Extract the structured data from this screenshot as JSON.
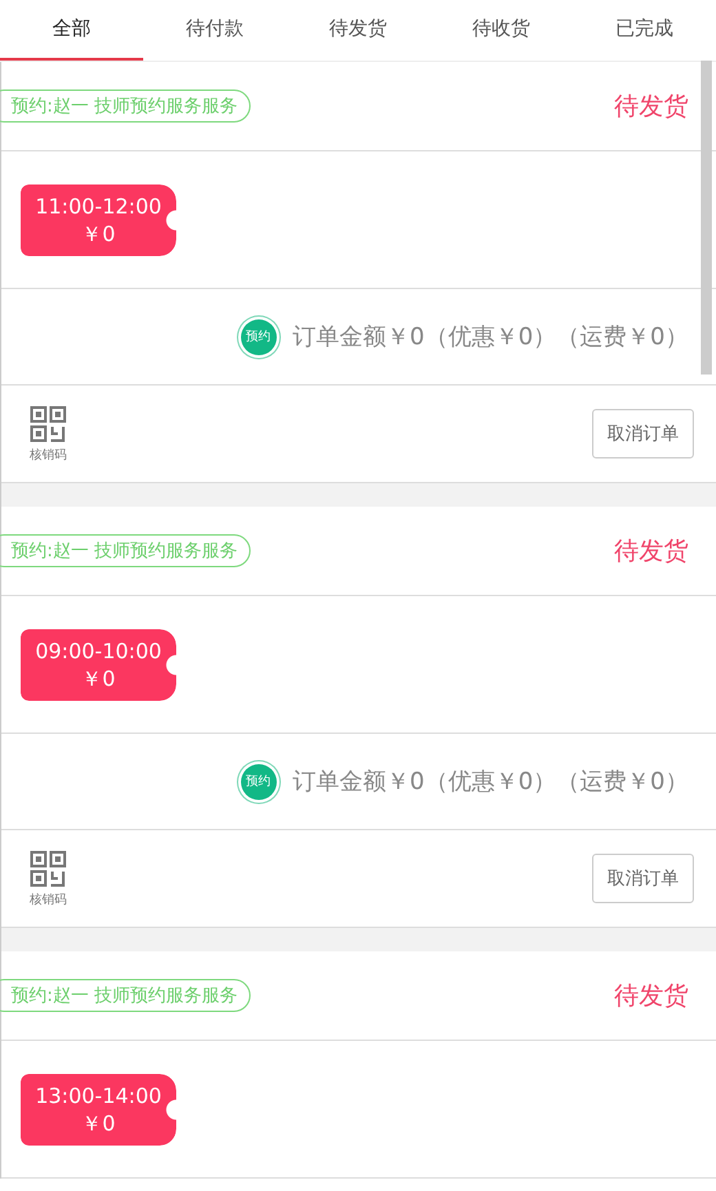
{
  "tabs": [
    {
      "label": "全部",
      "selected": true
    },
    {
      "label": "待付款",
      "selected": false
    },
    {
      "label": "待发货",
      "selected": false
    },
    {
      "label": "待收货",
      "selected": false
    },
    {
      "label": "已完成",
      "selected": false
    }
  ],
  "orders": [
    {
      "tag": "预约:赵一 技师预约服务服务",
      "status": "待发货",
      "slot": {
        "time": "11:00-12:00",
        "price": "￥0"
      },
      "badge": "预约",
      "total": "订单金额￥0（优惠￥0）（运费￥0）",
      "code_label": "核销码",
      "cancel_button": "取消订单"
    },
    {
      "tag": "预约:赵一 技师预约服务服务",
      "status": "待发货",
      "slot": {
        "time": "09:00-10:00",
        "price": "￥0"
      },
      "badge": "预约",
      "total": "订单金额￥0（优惠￥0）（运费￥0）",
      "code_label": "核销码",
      "cancel_button": "取消订单"
    },
    {
      "tag": "预约:赵一 技师预约服务服务",
      "status": "待发货",
      "slot": {
        "time": "13:00-14:00",
        "price": "￥0"
      }
    }
  ]
}
